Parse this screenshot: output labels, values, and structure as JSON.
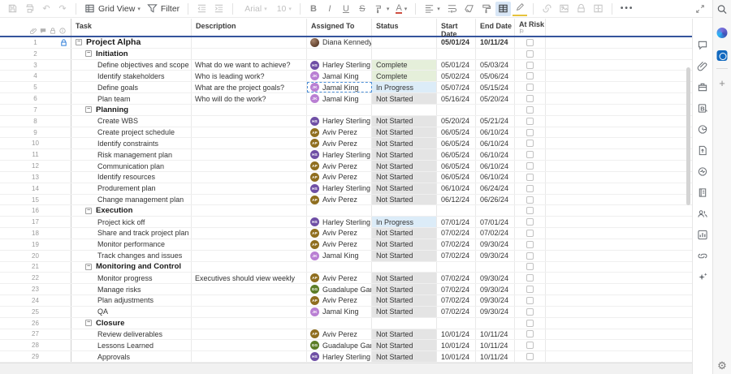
{
  "toolbar": {
    "view_button": "Grid View",
    "filter_button": "Filter",
    "font_family_value": "Arial",
    "font_size_value": "10",
    "bold": "B",
    "italic": "I",
    "underline": "U",
    "strikethrough": "S",
    "text_color_letter": "A",
    "more": "•••"
  },
  "columns": {
    "task": "Task",
    "description": "Description",
    "assigned_to": "Assigned To",
    "status": "Status",
    "start_date": "Start Date",
    "end_date": "End Date",
    "at_risk": "At Risk",
    "at_risk_flag": "⚐"
  },
  "status_colors": {
    "Complete": "#e5efda",
    "In Progress": "#dcecf8",
    "Not Started": "#e4e4e4"
  },
  "rows": [
    {
      "num": 1,
      "type": "project",
      "task": "Project Alpha",
      "description": "",
      "assignee": {
        "name": "Diana Kennedy",
        "initials": "DK",
        "color": "photo"
      },
      "status": "",
      "start": "05/01/24",
      "end": "10/11/24",
      "locked": true
    },
    {
      "num": 2,
      "type": "section",
      "task": "Initiation"
    },
    {
      "num": 3,
      "type": "task",
      "task": "Define objectives and scope",
      "description": "What do we want to achieve?",
      "assignee": {
        "name": "Harley Sterling",
        "initials": "HS",
        "color": "#6f4fa5"
      },
      "status": "Complete",
      "start": "05/01/24",
      "end": "05/03/24"
    },
    {
      "num": 4,
      "type": "task",
      "task": "Identify stakeholders",
      "description": "Who is leading work?",
      "assignee": {
        "name": "Jamal King",
        "initials": "JK",
        "color": "#b97fd3"
      },
      "status": "Complete",
      "start": "05/02/24",
      "end": "05/06/24"
    },
    {
      "num": 5,
      "type": "task",
      "task": "Define goals",
      "description": "What are the project goals?",
      "assignee": {
        "name": "Jamal King",
        "initials": "JK",
        "color": "#b97fd3"
      },
      "status": "In Progress",
      "start": "05/07/24",
      "end": "05/15/24",
      "selected": true
    },
    {
      "num": 6,
      "type": "task",
      "task": "Plan team",
      "description": "Who will do the work?",
      "assignee": {
        "name": "Jamal King",
        "initials": "JK",
        "color": "#b97fd3"
      },
      "status": "Not Started",
      "start": "05/16/24",
      "end": "05/20/24"
    },
    {
      "num": 7,
      "type": "section",
      "task": "Planning"
    },
    {
      "num": 8,
      "type": "task",
      "task": "Create WBS",
      "description": "",
      "assignee": {
        "name": "Harley Sterling",
        "initials": "HS",
        "color": "#6f4fa5"
      },
      "status": "Not Started",
      "start": "05/20/24",
      "end": "05/21/24"
    },
    {
      "num": 9,
      "type": "task",
      "task": "Create project schedule",
      "description": "",
      "assignee": {
        "name": "Aviv Perez",
        "initials": "AP",
        "color": "#8f6e1f"
      },
      "status": "Not Started",
      "start": "06/05/24",
      "end": "06/10/24"
    },
    {
      "num": 10,
      "type": "task",
      "task": "Identify constraints",
      "description": "",
      "assignee": {
        "name": "Aviv Perez",
        "initials": "AP",
        "color": "#8f6e1f"
      },
      "status": "Not Started",
      "start": "06/05/24",
      "end": "06/10/24"
    },
    {
      "num": 11,
      "type": "task",
      "task": "Risk management plan",
      "description": "",
      "assignee": {
        "name": "Harley Sterling",
        "initials": "HS",
        "color": "#6f4fa5"
      },
      "status": "Not Started",
      "start": "06/05/24",
      "end": "06/10/24"
    },
    {
      "num": 12,
      "type": "task",
      "task": "Communication plan",
      "description": "",
      "assignee": {
        "name": "Aviv Perez",
        "initials": "AP",
        "color": "#8f6e1f"
      },
      "status": "Not Started",
      "start": "06/05/24",
      "end": "06/10/24"
    },
    {
      "num": 13,
      "type": "task",
      "task": "Identify resources",
      "description": "",
      "assignee": {
        "name": "Aviv Perez",
        "initials": "AP",
        "color": "#8f6e1f"
      },
      "status": "Not Started",
      "start": "06/05/24",
      "end": "06/10/24"
    },
    {
      "num": 14,
      "type": "task",
      "task": "Produrement plan",
      "description": "",
      "assignee": {
        "name": "Harley Sterling",
        "initials": "HS",
        "color": "#6f4fa5"
      },
      "status": "Not Started",
      "start": "06/10/24",
      "end": "06/24/24"
    },
    {
      "num": 15,
      "type": "task",
      "task": "Change management plan",
      "description": "",
      "assignee": {
        "name": "Aviv Perez",
        "initials": "AP",
        "color": "#8f6e1f"
      },
      "status": "Not Started",
      "start": "06/12/24",
      "end": "06/26/24"
    },
    {
      "num": 16,
      "type": "section",
      "task": "Execution"
    },
    {
      "num": 17,
      "type": "task",
      "task": "Project kick off",
      "description": "",
      "assignee": {
        "name": "Harley Sterling",
        "initials": "HS",
        "color": "#6f4fa5"
      },
      "status": "In Progress",
      "start": "07/01/24",
      "end": "07/01/24"
    },
    {
      "num": 18,
      "type": "task",
      "task": "Share and track project plan",
      "description": "",
      "assignee": {
        "name": "Aviv Perez",
        "initials": "AP",
        "color": "#8f6e1f"
      },
      "status": "Not Started",
      "start": "07/02/24",
      "end": "07/02/24"
    },
    {
      "num": 19,
      "type": "task",
      "task": "Monitor performance",
      "description": "",
      "assignee": {
        "name": "Aviv Perez",
        "initials": "AP",
        "color": "#8f6e1f"
      },
      "status": "Not Started",
      "start": "07/02/24",
      "end": "09/30/24"
    },
    {
      "num": 20,
      "type": "task",
      "task": "Track changes and issues",
      "description": "",
      "assignee": {
        "name": "Jamal King",
        "initials": "JK",
        "color": "#b97fd3"
      },
      "status": "Not Started",
      "start": "07/02/24",
      "end": "09/30/24"
    },
    {
      "num": 21,
      "type": "section",
      "task": "Monitoring and Control"
    },
    {
      "num": 22,
      "type": "task",
      "task": "Monitor progress",
      "description": "Executives should view weekly",
      "assignee": {
        "name": "Aviv Perez",
        "initials": "AP",
        "color": "#8f6e1f"
      },
      "status": "Not Started",
      "start": "07/02/24",
      "end": "09/30/24"
    },
    {
      "num": 23,
      "type": "task",
      "task": "Manage risks",
      "description": "",
      "assignee": {
        "name": "Guadalupe Garcia",
        "initials": "GG",
        "color": "#5c7d26"
      },
      "status": "Not Started",
      "start": "07/02/24",
      "end": "09/30/24"
    },
    {
      "num": 24,
      "type": "task",
      "task": "Plan adjustments",
      "description": "",
      "assignee": {
        "name": "Aviv Perez",
        "initials": "AP",
        "color": "#8f6e1f"
      },
      "status": "Not Started",
      "start": "07/02/24",
      "end": "09/30/24"
    },
    {
      "num": 25,
      "type": "task",
      "task": "QA",
      "description": "",
      "assignee": {
        "name": "Jamal King",
        "initials": "JK",
        "color": "#b97fd3"
      },
      "status": "Not Started",
      "start": "07/02/24",
      "end": "09/30/24"
    },
    {
      "num": 26,
      "type": "section",
      "task": "Closure"
    },
    {
      "num": 27,
      "type": "task",
      "task": "Review deliverables",
      "description": "",
      "assignee": {
        "name": "Aviv Perez",
        "initials": "AP",
        "color": "#8f6e1f"
      },
      "status": "Not Started",
      "start": "10/01/24",
      "end": "10/11/24"
    },
    {
      "num": 28,
      "type": "task",
      "task": "Lessons Learned",
      "description": "",
      "assignee": {
        "name": "Guadalupe Garcia",
        "initials": "GG",
        "color": "#5c7d26"
      },
      "status": "Not Started",
      "start": "10/01/24",
      "end": "10/11/24"
    },
    {
      "num": 29,
      "type": "task",
      "task": "Approvals",
      "description": "",
      "assignee": {
        "name": "Harley Sterling",
        "initials": "HS",
        "color": "#6f4fa5"
      },
      "status": "Not Started",
      "start": "10/01/24",
      "end": "10/11/24"
    }
  ]
}
